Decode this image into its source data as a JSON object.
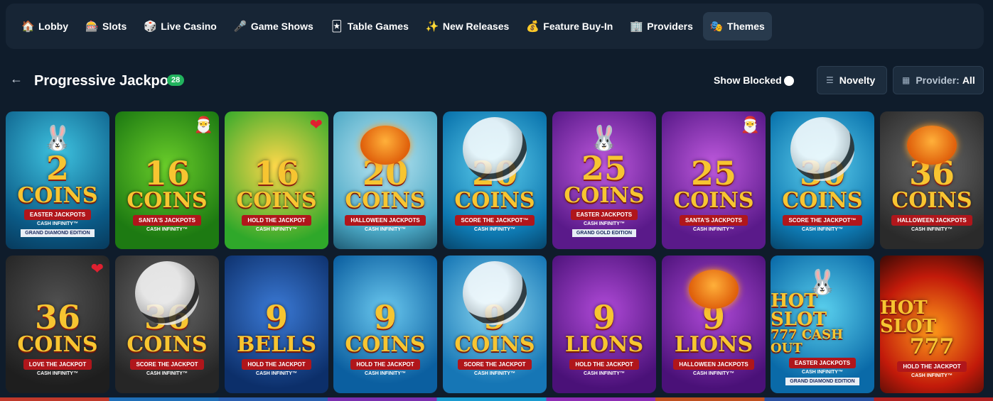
{
  "nav": {
    "items": [
      {
        "label": "Lobby",
        "icon": "🏠"
      },
      {
        "label": "Slots",
        "icon": "🎰"
      },
      {
        "label": "Live Casino",
        "icon": "🎲"
      },
      {
        "label": "Game Shows",
        "icon": "🎤"
      },
      {
        "label": "Table Games",
        "icon": "🃏"
      },
      {
        "label": "New Releases",
        "icon": "✨"
      },
      {
        "label": "Feature Buy-In",
        "icon": "💰"
      },
      {
        "label": "Providers",
        "icon": "🏢"
      },
      {
        "label": "Themes",
        "icon": "🎭"
      }
    ],
    "active": "Themes"
  },
  "header": {
    "title": "Progressive Jackpot",
    "count": "28",
    "show_blocked_label": "Show Blocked",
    "sort_label": "Novelty",
    "provider_prefix": "Provider:",
    "provider_value": "All"
  },
  "games": [
    {
      "num": "2",
      "word": "COINS",
      "ribbon": "EASTER JACKPOTS",
      "sub": "CASH INFINITY™",
      "edition": "GRAND DIAMOND EDITION",
      "theme": "easter"
    },
    {
      "num": "16",
      "word": "COINS",
      "ribbon": "SANTA'S JACKPOTS",
      "sub": "CASH INFINITY™",
      "edition": "",
      "theme": "santa"
    },
    {
      "num": "16",
      "word": "COINS",
      "ribbon": "HOLD THE JACKPOT",
      "sub": "CASH INFINITY™",
      "edition": "",
      "theme": "love"
    },
    {
      "num": "20",
      "word": "COINS",
      "ribbon": "HALLOWEEN JACKPOTS",
      "sub": "CASH INFINITY™",
      "edition": "",
      "theme": "halloween"
    },
    {
      "num": "20",
      "word": "COINS",
      "ribbon": "SCORE THE JACKPOT™",
      "sub": "CASH INFINITY™",
      "edition": "",
      "theme": "soccer"
    },
    {
      "num": "25",
      "word": "COINS",
      "ribbon": "EASTER JACKPOTS",
      "sub": "CASH INFINITY™",
      "edition": "GRAND GOLD EDITION",
      "theme": "easter-purple"
    },
    {
      "num": "25",
      "word": "COINS",
      "ribbon": "SANTA'S JACKPOTS",
      "sub": "CASH INFINITY™",
      "edition": "",
      "theme": "santa-purple"
    },
    {
      "num": "30",
      "word": "COINS",
      "ribbon": "SCORE THE JACKPOT™",
      "sub": "CASH INFINITY™",
      "edition": "",
      "theme": "soccer"
    },
    {
      "num": "36",
      "word": "COINS",
      "ribbon": "HALLOWEEN JACKPOTS",
      "sub": "CASH INFINITY™",
      "edition": "",
      "theme": "halloween-dark"
    },
    {
      "num": "36",
      "word": "COINS",
      "ribbon": "LOVE THE JACKPOT",
      "sub": "CASH INFINITY™",
      "edition": "",
      "theme": "love-dark"
    },
    {
      "num": "36",
      "word": "COINS",
      "ribbon": "SCORE THE JACKPOT",
      "sub": "CASH INFINITY™",
      "edition": "",
      "theme": "soccer-dark"
    },
    {
      "num": "9",
      "word": "BELLS",
      "ribbon": "HOLD THE JACKPOT",
      "sub": "CASH INFINITY™",
      "edition": "",
      "theme": "bells"
    },
    {
      "num": "9",
      "word": "COINS",
      "ribbon": "HOLD THE JACKPOT",
      "sub": "CASH INFINITY™",
      "edition": "",
      "theme": "blue-gold"
    },
    {
      "num": "9",
      "word": "COINS",
      "ribbon": "SCORE THE JACKPOT",
      "sub": "CASH INFINITY™",
      "edition": "",
      "theme": "soccer-blue"
    },
    {
      "num": "9",
      "word": "LIONS",
      "ribbon": "HOLD THE JACKPOT",
      "sub": "CASH INFINITY™",
      "edition": "",
      "theme": "lions"
    },
    {
      "num": "9",
      "word": "LIONS",
      "ribbon": "HALLOWEEN JACKPOTS",
      "sub": "CASH INFINITY™",
      "edition": "",
      "theme": "halloween-purple"
    },
    {
      "num": "HOT SLOT",
      "word": "777 CASH OUT",
      "ribbon": "EASTER JACKPOTS",
      "sub": "CASH INFINITY™",
      "edition": "GRAND DIAMOND EDITION",
      "theme": "hot-easter"
    },
    {
      "num": "HOT SLOT",
      "word": "777",
      "ribbon": "HOLD THE JACKPOT",
      "sub": "CASH INFINITY™",
      "edition": "",
      "theme": "hot-fire"
    }
  ]
}
